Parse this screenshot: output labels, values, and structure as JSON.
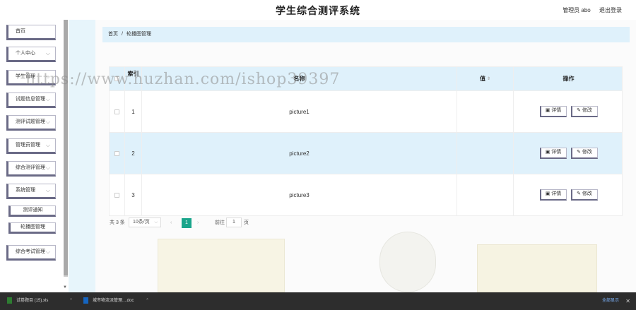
{
  "header": {
    "title": "学生综合测评系统",
    "role_user": "管理员 abo",
    "logout": "退出登录"
  },
  "sidebar": {
    "items": [
      {
        "label": "首页",
        "has_chevron": false
      },
      {
        "label": "个人中心",
        "has_chevron": true
      },
      {
        "label": "学生管理",
        "has_chevron": true
      },
      {
        "label": "试题信息管理",
        "has_chevron": true
      },
      {
        "label": "测评试题管理",
        "has_chevron": true
      },
      {
        "label": "管理员管理",
        "has_chevron": true
      },
      {
        "label": "综合测评管理",
        "has_chevron": true
      },
      {
        "label": "系统管理",
        "has_chevron": true
      },
      {
        "label": "测评通知",
        "sub": true
      },
      {
        "label": "轮播图管理",
        "sub": true,
        "active": true
      },
      {
        "label": "综合考试管理",
        "has_chevron": true
      }
    ],
    "chevron_icon": "chevron-down-icon"
  },
  "breadcrumb": {
    "home": "首页",
    "separator": "/",
    "current": "轮播图管理"
  },
  "table": {
    "columns": {
      "index": "索引",
      "name": "名称",
      "value": "值",
      "actions": "操作"
    },
    "rows": [
      {
        "index": "1",
        "name": "picture1",
        "value": ""
      },
      {
        "index": "2",
        "name": "picture2",
        "value": ""
      },
      {
        "index": "3",
        "name": "picture3",
        "value": ""
      }
    ],
    "detail_label": "详情",
    "edit_label": "修改"
  },
  "pagination": {
    "total": "共 3 条",
    "page_size": "10条/页",
    "current_page": "1",
    "goto_label": "前往",
    "goto_value": "1",
    "page_suffix": "页"
  },
  "watermark": "https://www.huzhan.com/ishop39397",
  "taskbar": {
    "downloads": [
      {
        "name": "试卷题目 (15).xls",
        "type": "xls"
      },
      {
        "name": "城市物流派管理....doc",
        "type": "doc"
      }
    ],
    "show_all": "全部显示"
  },
  "colors": {
    "accent": "#1aa58b",
    "header_bg": "#dff1fb",
    "sidebar_bg": "#e7f5fb",
    "button_border": "#6a6a86"
  }
}
